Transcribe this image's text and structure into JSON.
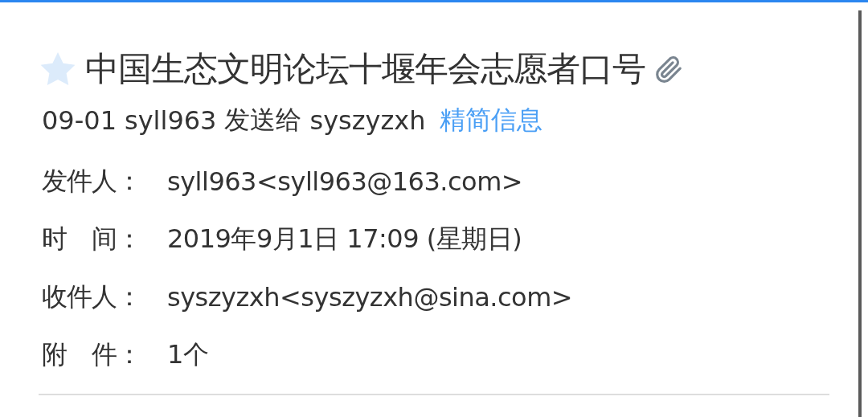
{
  "message": {
    "starred": false,
    "subject": "中国生态文明论坛十堰年会志愿者口号",
    "has_attachment": true,
    "summary": {
      "date": "09-01",
      "sender": "syll963",
      "verb": "发送给",
      "recipient": "syszyzxh",
      "toggle": "精简信息"
    },
    "fields": [
      {
        "label": "发件人：",
        "value": "syll963<syll963@163.com>"
      },
      {
        "label": "时　间：",
        "value": "2019年9月1日 17:09 (星期日)"
      },
      {
        "label": "收件人：",
        "value": "syszyzxh<syszyzxh@sina.com>"
      },
      {
        "label": "附　件：",
        "value": "1个"
      }
    ]
  }
}
